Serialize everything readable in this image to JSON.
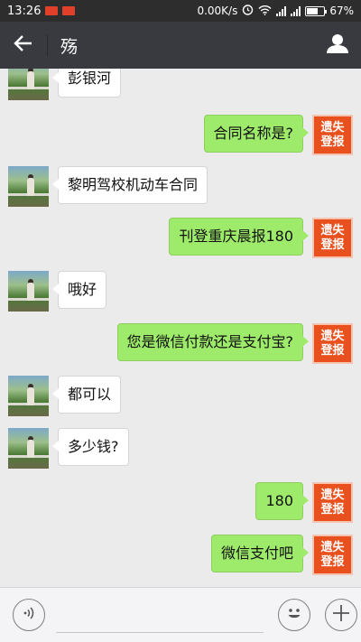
{
  "status_bar": {
    "time": "13:26",
    "net_speed": "0.00K/s",
    "battery": "67%",
    "battery_level": 0.67
  },
  "header": {
    "title": "殇",
    "back_icon": "arrow-left-icon",
    "profile_icon": "person-icon"
  },
  "badge": {
    "line1": "遗失",
    "line2": "登报"
  },
  "messages": [
    {
      "side": "left",
      "text": "彭银河"
    },
    {
      "side": "right",
      "text": "合同名称是?"
    },
    {
      "side": "left",
      "text": "黎明驾校机动车合同"
    },
    {
      "side": "right",
      "text": "刊登重庆晨报180"
    },
    {
      "side": "left",
      "text": "哦好"
    },
    {
      "side": "right",
      "text": "您是微信付款还是支付宝?"
    },
    {
      "side": "left",
      "text": "都可以"
    },
    {
      "side": "left",
      "text": "多少钱?"
    },
    {
      "side": "right",
      "text": "180"
    },
    {
      "side": "right",
      "text": "微信支付吧"
    },
    {
      "side": "left",
      "text": ""
    }
  ],
  "input_bar": {
    "voice_icon": "voice-icon",
    "input_value": "",
    "emoji_icon": "emoji-icon",
    "plus_icon": "plus-icon"
  }
}
